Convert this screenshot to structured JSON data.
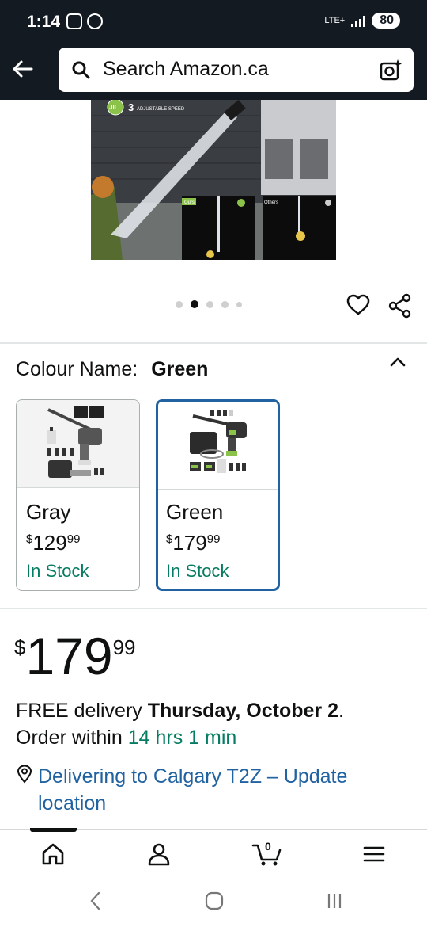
{
  "status_bar": {
    "time": "1:14",
    "network": "LTE+",
    "battery": "80"
  },
  "search": {
    "placeholder": "Search Amazon.ca"
  },
  "hero": {
    "badge_brand": "JIL",
    "badge_number": "3",
    "badge_text": "ADJUSTABLE SPEED",
    "compare_ours": "Ours",
    "compare_others": "Others"
  },
  "carousel": {
    "total": 5,
    "active_index": 1
  },
  "colour": {
    "label": "Colour Name:",
    "value": "Green"
  },
  "variants": [
    {
      "name": "Gray",
      "currency": "$",
      "price_whole": "129",
      "price_cents": "99",
      "stock": "In Stock",
      "selected": false
    },
    {
      "name": "Green",
      "currency": "$",
      "price_whole": "179",
      "price_cents": "99",
      "stock": "In Stock",
      "selected": true
    }
  ],
  "price": {
    "currency": "$",
    "whole": "179",
    "cents": "99"
  },
  "delivery": {
    "prefix": "FREE delivery ",
    "date": "Thursday, October 2",
    "suffix": ".",
    "order_prefix": "Order within ",
    "countdown": "14 hrs 1 min"
  },
  "location": {
    "text": "Delivering to Calgary T2Z – Update location"
  },
  "bottom_nav": {
    "cart_count": "0",
    "items": [
      "home",
      "account",
      "cart",
      "menu"
    ]
  },
  "colors": {
    "header_bg": "#131a22",
    "link": "#2162a1",
    "green": "#067d62",
    "selected_border": "#2162a1"
  }
}
